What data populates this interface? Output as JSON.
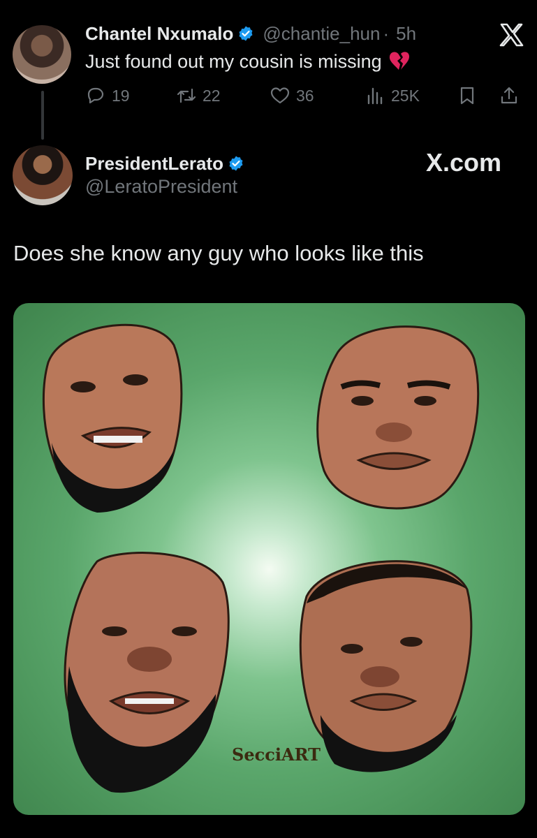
{
  "tweet1": {
    "author_name": "Chantel Nxumalo",
    "handle": "@chantie_hun",
    "separator": "·",
    "time": "5h",
    "text": "Just found out my cousin is missing",
    "emoji_icon": "broken-heart-icon",
    "stats": {
      "replies": "19",
      "retweets": "22",
      "likes": "36",
      "views": "25K"
    },
    "brand_icon": "x-logo-icon"
  },
  "tweet2": {
    "author_name": "PresidentLerato",
    "handle": "@LeratoPresident",
    "brand_text": "X.com",
    "text": "Does she know any guy who looks like this"
  },
  "media": {
    "description_icon": "four-faces-illustration",
    "artist_signature": "SecciART"
  },
  "colors": {
    "background": "#000000",
    "text": "#e7e9ea",
    "muted": "#71767b",
    "verified_blue": "#1d9bf0",
    "image_green": "#5aa66b"
  }
}
